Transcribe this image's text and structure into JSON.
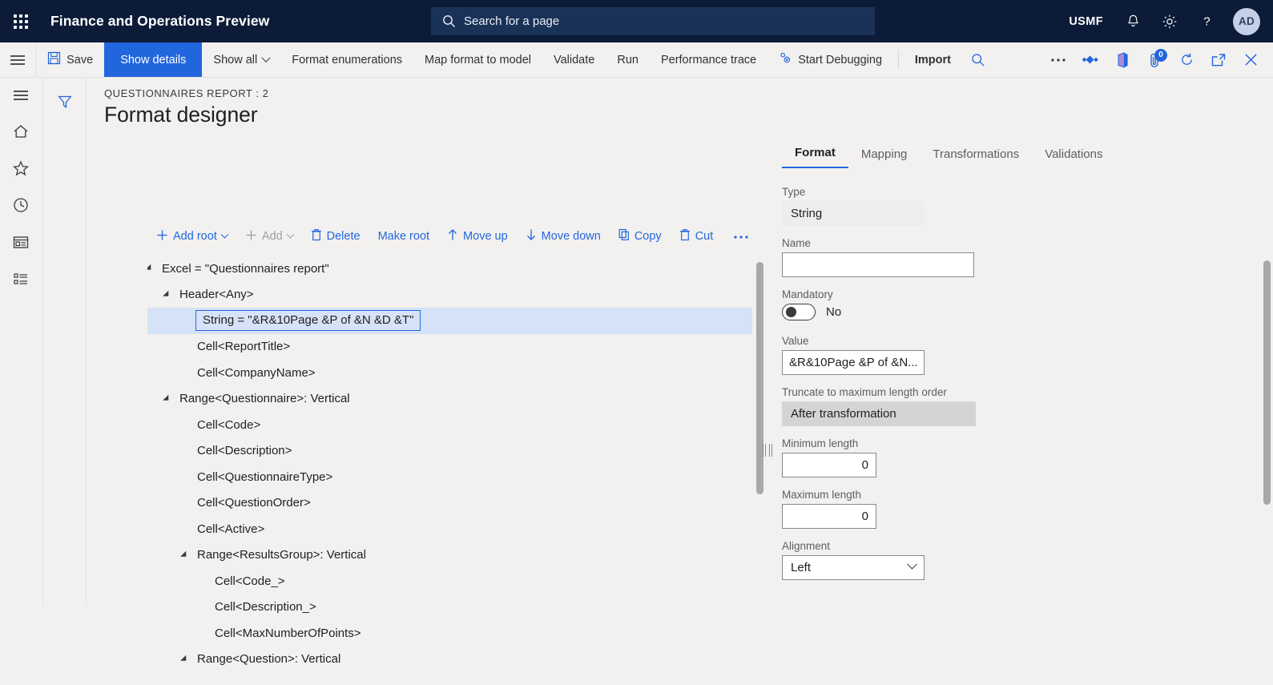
{
  "topnav": {
    "waffle_icon": "app-launcher-icon",
    "app_title": "Finance and Operations Preview",
    "search": {
      "placeholder": "Search for a page",
      "icon": "search-icon"
    },
    "company": "USMF",
    "notifications_icon": "bell-icon",
    "settings_icon": "gear-icon",
    "help_icon": "question-mark-icon",
    "avatar_initials": "AD"
  },
  "commandbar": {
    "hamburger_icon": "hamburger-menu-icon",
    "items": [
      {
        "label": "Save",
        "icon": "save-disk-icon",
        "style": "normal"
      },
      {
        "label": "Show details",
        "icon": "",
        "style": "primary"
      },
      {
        "label": "Show all",
        "icon": "",
        "style": "dropdown"
      },
      {
        "label": "Format enumerations",
        "icon": "",
        "style": "normal"
      },
      {
        "label": "Map format to model",
        "icon": "",
        "style": "normal"
      },
      {
        "label": "Validate",
        "icon": "",
        "style": "normal"
      },
      {
        "label": "Run",
        "icon": "",
        "style": "normal"
      },
      {
        "label": "Performance trace",
        "icon": "",
        "style": "normal"
      },
      {
        "label": "Start Debugging",
        "icon": "debug-gears-icon",
        "style": "normal"
      },
      {
        "label": "Import",
        "icon": "",
        "style": "bold"
      }
    ],
    "right_icons": [
      "search-icon",
      "overflow-ellipsis-icon",
      "share-diamonds-icon",
      "office-app-icon",
      "attachments-icon",
      "refresh-icon",
      "open-in-new-window-icon",
      "close-icon"
    ],
    "attachment_badge": "0"
  },
  "rail": {
    "items": [
      "hamburger-menu-icon",
      "home-icon",
      "favorites-star-icon",
      "recent-clock-icon",
      "workspaces-icon",
      "modules-list-icon"
    ]
  },
  "page": {
    "filter_icon": "filter-funnel-icon",
    "breadcrumb": "QUESTIONNAIRES REPORT : 2",
    "title": "Format designer"
  },
  "tree_toolbar": {
    "items": [
      {
        "label": "Add root",
        "icon": "plus-icon",
        "dropdown": true,
        "disabled": false
      },
      {
        "label": "Add",
        "icon": "plus-icon",
        "dropdown": true,
        "disabled": true
      },
      {
        "label": "Delete",
        "icon": "trash-icon",
        "dropdown": false,
        "disabled": false
      },
      {
        "label": "Make root",
        "icon": "",
        "dropdown": false,
        "disabled": false
      },
      {
        "label": "Move up",
        "icon": "arrow-up-icon",
        "dropdown": false,
        "disabled": false
      },
      {
        "label": "Move down",
        "icon": "arrow-down-icon",
        "dropdown": false,
        "disabled": false
      },
      {
        "label": "Copy",
        "icon": "copy-icon",
        "dropdown": false,
        "disabled": false
      },
      {
        "label": "Cut",
        "icon": "cut-trash-icon",
        "dropdown": false,
        "disabled": false
      },
      {
        "label": "…",
        "icon": "",
        "dropdown": false,
        "disabled": false
      }
    ]
  },
  "tree": {
    "nodes": [
      {
        "label": "Excel = \"Questionnaires report\"",
        "indent": 0,
        "expandable": true,
        "selected": false
      },
      {
        "label": "Header<Any>",
        "indent": 1,
        "expandable": true,
        "selected": false
      },
      {
        "label": "String = \"&R&10Page &P of &N &D &T\"",
        "indent": 2,
        "expandable": false,
        "selected": true
      },
      {
        "label": "Cell<ReportTitle>",
        "indent": 2,
        "expandable": false,
        "selected": false
      },
      {
        "label": "Cell<CompanyName>",
        "indent": 2,
        "expandable": false,
        "selected": false
      },
      {
        "label": "Range<Questionnaire>: Vertical",
        "indent": 1,
        "expandable": true,
        "selected": false
      },
      {
        "label": "Cell<Code>",
        "indent": 2,
        "expandable": false,
        "selected": false
      },
      {
        "label": "Cell<Description>",
        "indent": 2,
        "expandable": false,
        "selected": false
      },
      {
        "label": "Cell<QuestionnaireType>",
        "indent": 2,
        "expandable": false,
        "selected": false
      },
      {
        "label": "Cell<QuestionOrder>",
        "indent": 2,
        "expandable": false,
        "selected": false
      },
      {
        "label": "Cell<Active>",
        "indent": 2,
        "expandable": false,
        "selected": false
      },
      {
        "label": "Range<ResultsGroup>: Vertical",
        "indent": 2,
        "expandable": true,
        "selected": false
      },
      {
        "label": "Cell<Code_>",
        "indent": 3,
        "expandable": false,
        "selected": false
      },
      {
        "label": "Cell<Description_>",
        "indent": 3,
        "expandable": false,
        "selected": false
      },
      {
        "label": "Cell<MaxNumberOfPoints>",
        "indent": 3,
        "expandable": false,
        "selected": false
      },
      {
        "label": "Range<Question>: Vertical",
        "indent": 2,
        "expandable": true,
        "selected": false
      }
    ]
  },
  "rightpanel": {
    "tabs": [
      {
        "label": "Format",
        "active": true
      },
      {
        "label": "Mapping",
        "active": false
      },
      {
        "label": "Transformations",
        "active": false
      },
      {
        "label": "Validations",
        "active": false
      }
    ],
    "fields": {
      "type_label": "Type",
      "type_value": "String",
      "name_label": "Name",
      "name_value": "",
      "name_placeholder": "",
      "mandatory_label": "Mandatory",
      "mandatory_value": "No",
      "value_label": "Value",
      "value_value": "&R&10Page &P of &N...",
      "truncate_label": "Truncate to maximum length order",
      "truncate_value": "After transformation",
      "min_length_label": "Minimum length",
      "min_length_value": "0",
      "max_length_label": "Maximum length",
      "max_length_value": "0",
      "alignment_label": "Alignment",
      "alignment_value": "Left"
    }
  },
  "colors": {
    "nav_bg": "#0b1b38",
    "accent": "#2266dd",
    "page_bg": "#f2f1f0",
    "selection": "#d6e2f7"
  }
}
